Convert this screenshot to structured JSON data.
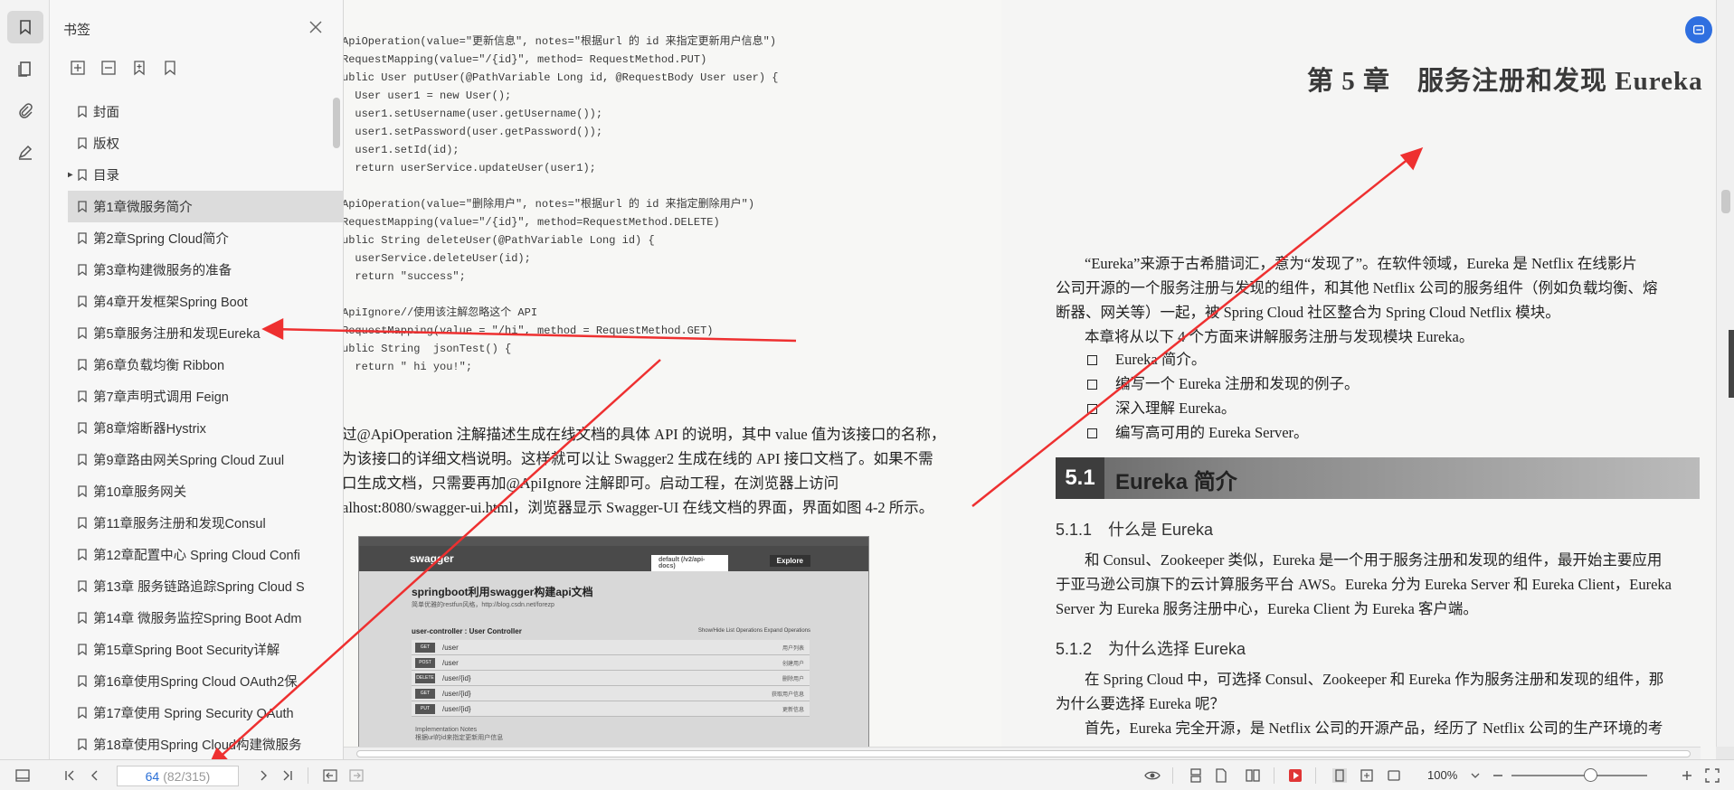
{
  "panel": {
    "title": "书签",
    "bookmarks": [
      {
        "label": "封面",
        "expandable": false,
        "active": false
      },
      {
        "label": "版权",
        "expandable": false,
        "active": false
      },
      {
        "label": "目录",
        "expandable": true,
        "active": false
      },
      {
        "label": "第1章微服务简介",
        "expandable": false,
        "active": true
      },
      {
        "label": "第2章Spring Cloud简介",
        "expandable": false,
        "active": false
      },
      {
        "label": "第3章构建微服务的准备",
        "expandable": false,
        "active": false
      },
      {
        "label": "第4章开发框架Spring Boot",
        "expandable": false,
        "active": false
      },
      {
        "label": "第5章服务注册和发现Eureka",
        "expandable": false,
        "active": false
      },
      {
        "label": "第6章负载均衡 Ribbon",
        "expandable": false,
        "active": false
      },
      {
        "label": "第7章声明式调用 Feign",
        "expandable": false,
        "active": false
      },
      {
        "label": "第8章熔断器Hystrix",
        "expandable": false,
        "active": false
      },
      {
        "label": "第9章路由网关Spring Cloud Zuul",
        "expandable": false,
        "active": false
      },
      {
        "label": "第10章服务网关",
        "expandable": false,
        "active": false
      },
      {
        "label": "第11章服务注册和发现Consul",
        "expandable": false,
        "active": false
      },
      {
        "label": "第12章配置中心 Spring Cloud Confi",
        "expandable": false,
        "active": false
      },
      {
        "label": "第13章 服务链路追踪Spring Cloud S",
        "expandable": false,
        "active": false
      },
      {
        "label": "第14章 微服务监控Spring Boot Adm",
        "expandable": false,
        "active": false
      },
      {
        "label": "第15章Spring Boot Security详解",
        "expandable": false,
        "active": false
      },
      {
        "label": "第16章使用Spring Cloud OAuth2保",
        "expandable": false,
        "active": false
      },
      {
        "label": "第17章使用 Spring Security OAuth",
        "expandable": false,
        "active": false
      },
      {
        "label": "第18章使用Spring Cloud构建微服务",
        "expandable": false,
        "active": false
      }
    ]
  },
  "left_page": {
    "code_block_1": [
      "ApiOperation(value=\"更新信息\", notes=\"根据url 的 id 来指定更新用户信息\")",
      "RequestMapping(value=\"/{id}\", method= RequestMethod.PUT)",
      "ublic User putUser(@PathVariable Long id, @RequestBody User user) {",
      "  User user1 = new User();",
      "  user1.setUsername(user.getUsername());",
      "  user1.setPassword(user.getPassword());",
      "  user1.setId(id);",
      "  return userService.updateUser(user1);",
      "",
      "ApiOperation(value=\"删除用户\", notes=\"根据url 的 id 来指定删除用户\")",
      "RequestMapping(value=\"/{id}\", method=RequestMethod.DELETE)",
      "ublic String deleteUser(@PathVariable Long id) {",
      "  userService.deleteUser(id);",
      "  return \"success\";",
      "",
      "ApiIgnore//使用该注解忽略这个 API",
      "RequestMapping(value = \"/hi\", method = RequestMethod.GET)",
      "ublic String  jsonTest() {",
      "  return \" hi you!\";"
    ],
    "paragraph": [
      "过@ApiOperation 注解描述生成在线文档的具体 API 的说明，其中 value 值为该接口的名称，",
      "为该接口的详细文档说明。这样就可以让 Swagger2 生成在线的 API 接口文档了。如果不需",
      "口生成文档，只需要再加@ApiIgnore 注解即可。启动工程，在浏览器上访问",
      "alhost:8080/swagger-ui.html，浏览器显示 Swagger-UI 在线文档的界面，界面如图 4-2 所示。"
    ],
    "figure": {
      "logo": "swagger",
      "api_url": "default (/v2/api-docs)",
      "explore": "Explore",
      "title": "springboot利用swagger构建api文档",
      "subtitle": "简单优雅的restfun风格，http://blog.csdn.net/forezp",
      "controller": "user-controller : User Controller",
      "ops": "Show/Hide   List Operations   Expand Operations",
      "rows": [
        {
          "method": "GET",
          "path": "/user",
          "desc": "用户列表"
        },
        {
          "method": "POST",
          "path": "/user",
          "desc": "创建用户"
        },
        {
          "method": "DELETE",
          "path": "/user/{id}",
          "desc": "删除用户"
        },
        {
          "method": "GET",
          "path": "/user/{id}",
          "desc": "获取用户信息"
        },
        {
          "method": "PUT",
          "path": "/user/{id}",
          "desc": "更新信息"
        }
      ],
      "impl": "Implementation Notes",
      "impl2": "根据url的id来指定更新用户信息"
    }
  },
  "right_page": {
    "chapter_title": "第 5 章　服务注册和发现 Eureka",
    "intro": [
      "“Eureka”来源于古希腊词汇，意为“发现了”。在软件领域，Eureka 是 Netflix 在线影片",
      "公司开源的一个服务注册与发现的组件，和其他 Netflix 公司的服务组件（例如负载均衡、熔",
      "断器、网关等）一起，被 Spring Cloud 社区整合为 Spring Cloud Netflix 模块。",
      "本章将从以下 4 个方面来讲解服务注册与发现模块 Eureka。"
    ],
    "list": [
      "Eureka 简介。",
      "编写一个 Eureka 注册和发现的例子。",
      "深入理解 Eureka。",
      "编写高可用的 Eureka Server。"
    ],
    "section_num": "5.1",
    "section_name": "Eureka 简介",
    "sub1": "5.1.1　什么是 Eureka",
    "sub1_text": [
      "和 Consul、Zookeeper 类似，Eureka 是一个用于服务注册和发现的组件，最开始主要应用",
      "于亚马逊公司旗下的云计算服务平台 AWS。Eureka 分为 Eureka Server 和 Eureka Client，Eureka",
      "Server 为 Eureka 服务注册中心，Eureka Client 为 Eureka 客户端。"
    ],
    "sub2": "5.1.2　为什么选择 Eureka",
    "sub2_text": [
      "在 Spring Cloud 中，可选择 Consul、Zookeeper 和 Eureka 作为服务注册和发现的组件，那",
      "为什么要选择 Eureka 呢？",
      "首先，Eureka 完全开源，是 Netflix 公司的开源产品，经历了 Netflix 公司的生产环境的考"
    ]
  },
  "toolbar": {
    "current_page": "64",
    "page_total": "(82/315)",
    "zoom": "100%"
  },
  "colors": {
    "annotation": "#ee3030",
    "accent": "#2a6fd6",
    "active_bookmark": "#dcdcdc"
  }
}
